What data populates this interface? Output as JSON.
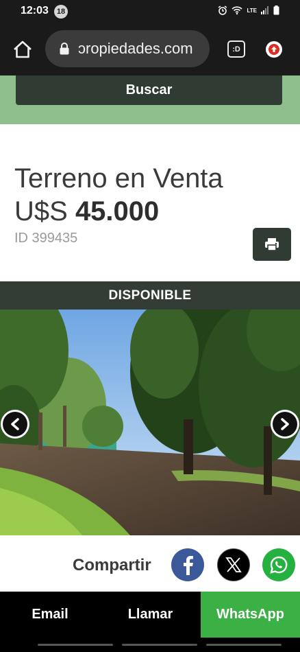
{
  "status_bar": {
    "time": "12:03",
    "notification_count": "18",
    "network_label": "LTE"
  },
  "browser": {
    "url_display": "ɔropiedades.com",
    "tab_label": ":D"
  },
  "search": {
    "button_label": "Buscar"
  },
  "property": {
    "title": "Terreno en Venta",
    "currency": "U$S",
    "price": "45.000",
    "id_label": "ID 399435",
    "status": "DISPONIBLE"
  },
  "share": {
    "label": "Compartir",
    "networks": [
      "facebook-icon",
      "x-icon",
      "whatsapp-icon"
    ]
  },
  "actions": {
    "email": "Email",
    "call": "Llamar",
    "whatsapp": "WhatsApp"
  },
  "colors": {
    "brand_dark": "#2f3b33",
    "brand_light": "#8fbf8c",
    "whatsapp": "#3ab045",
    "facebook": "#3b5998"
  }
}
